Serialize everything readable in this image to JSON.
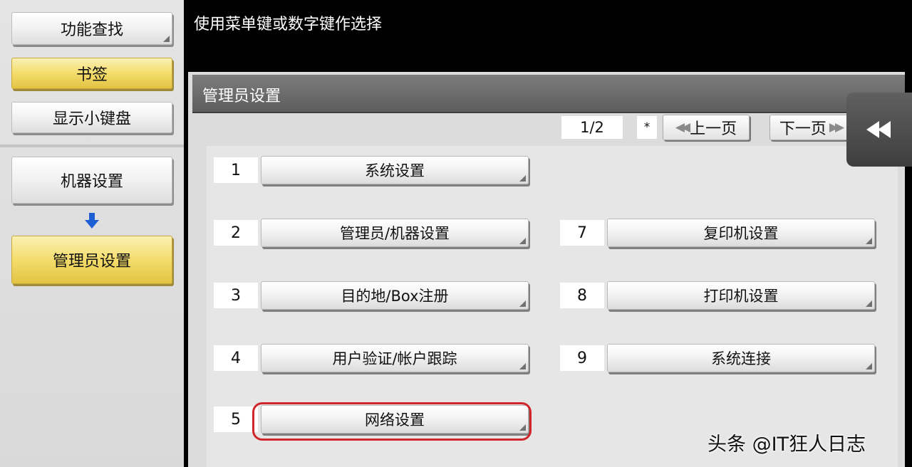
{
  "sidebar": {
    "function_search": "功能查找",
    "bookmark": "书签",
    "show_keypad": "显示小键盘",
    "machine_settings": "机器设置",
    "admin_settings": "管理员设置"
  },
  "topbar": {
    "instruction": "使用菜单键或数字键作选择"
  },
  "panel": {
    "title": "管理员设置",
    "page_indicator": "1/2",
    "star": "*",
    "prev_label": "上一页",
    "next_label": "下一页"
  },
  "menu": {
    "items": [
      {
        "num": "1",
        "label": "系统设置"
      },
      {
        "num": "2",
        "label": "管理员/机器设置"
      },
      {
        "num": "3",
        "label": "目的地/Box注册"
      },
      {
        "num": "4",
        "label": "用户验证/帐户跟踪"
      },
      {
        "num": "5",
        "label": "网络设置"
      },
      {
        "num": "7",
        "label": "复印机设置"
      },
      {
        "num": "8",
        "label": "打印机设置"
      },
      {
        "num": "9",
        "label": "系统连接"
      }
    ]
  },
  "watermark": "头条 @IT狂人日志",
  "colors": {
    "selected_yellow": "#f4dd6c",
    "highlight_red": "#d0262b",
    "header_gray": "#6a6a6a"
  },
  "icons": {
    "down_arrow": "arrow-down-icon",
    "back": "double-left-arrow-icon",
    "prev": "double-left-arrow-icon",
    "next": "double-right-arrow-icon"
  }
}
